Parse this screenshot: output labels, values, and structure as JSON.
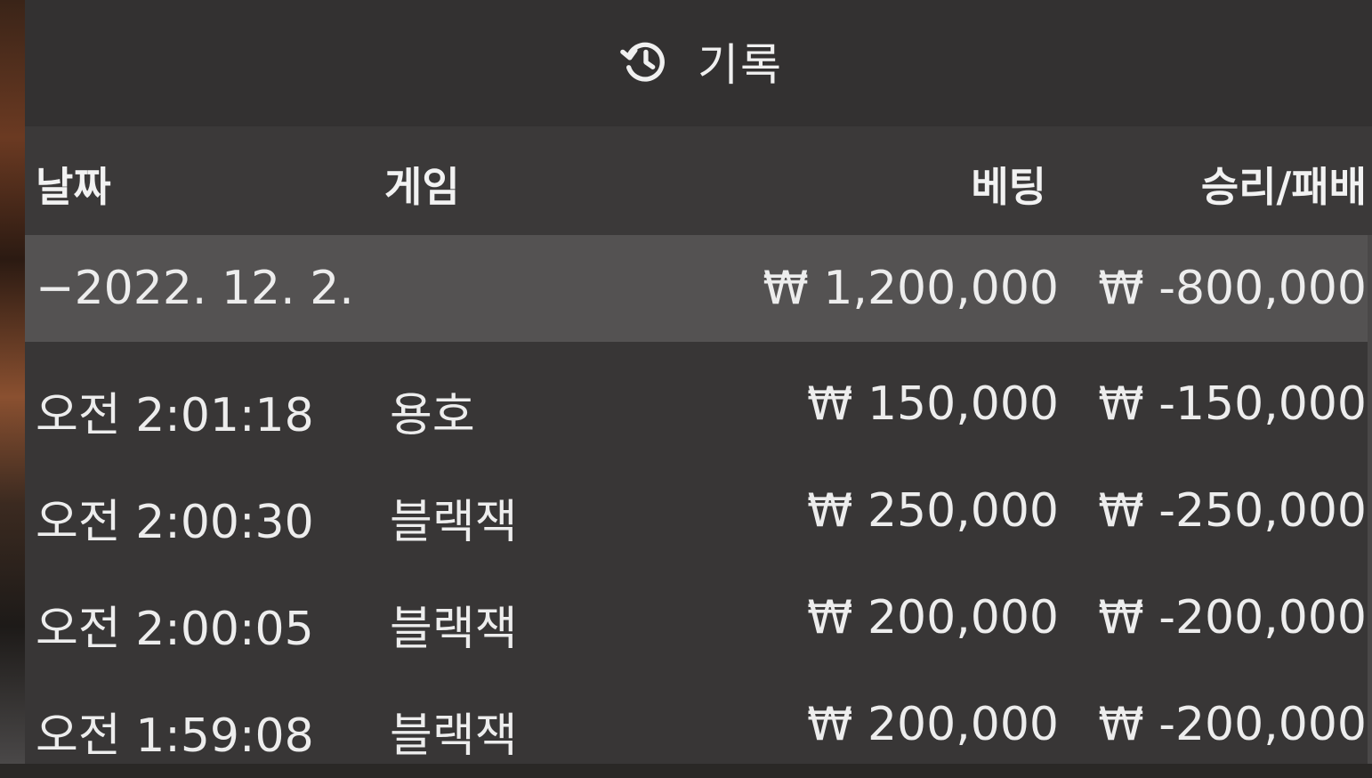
{
  "title": {
    "icon": "history-icon",
    "label": "기록"
  },
  "columns": {
    "date": "날짜",
    "game": "게임",
    "bet": "베팅",
    "result": "승리/패배"
  },
  "group": {
    "toggle": "−",
    "date": "2022. 12. 2.",
    "bet": "₩ 1,200,000",
    "result": "₩ -800,000"
  },
  "rows": [
    {
      "time": "오전 2:01:18",
      "game": "용호",
      "bet": "₩ 150,000",
      "result": "₩ -150,000"
    },
    {
      "time": "오전 2:00:30",
      "game": "블랙잭",
      "bet": "₩ 250,000",
      "result": "₩ -250,000"
    },
    {
      "time": "오전 2:00:05",
      "game": "블랙잭",
      "bet": "₩ 200,000",
      "result": "₩ -200,000"
    },
    {
      "time": "오전 1:59:08",
      "game": "블랙잭",
      "bet": "₩ 200,000",
      "result": "₩ -200,000"
    }
  ],
  "colors": {
    "panel": "#383636",
    "group_row": "#545252",
    "text": "#ededed"
  }
}
